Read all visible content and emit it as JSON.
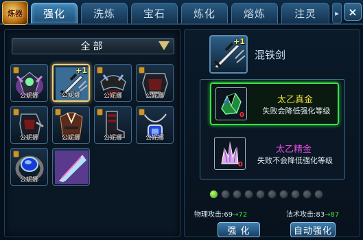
{
  "logo_text": "炼器",
  "tabs": [
    {
      "label": "强化",
      "active": true
    },
    {
      "label": "洗炼",
      "active": false
    },
    {
      "label": "宝石",
      "active": false
    },
    {
      "label": "炼化",
      "active": false
    },
    {
      "label": "熔炼",
      "active": false
    },
    {
      "label": "注灵",
      "active": false
    }
  ],
  "tab_more_icon": "chevron-right-icon",
  "close_label": "×",
  "filter": {
    "selected": "全部"
  },
  "inventory": [
    {
      "owner": "公妮娜",
      "icon": "armor-green-icon",
      "plus": "",
      "selected": false
    },
    {
      "owner": "公妮娜",
      "icon": "sword-icon",
      "plus": "+1",
      "selected": true
    },
    {
      "owner": "公妮娜",
      "icon": "shoulder-armor-icon",
      "plus": "",
      "selected": false
    },
    {
      "owner": "公妮娜",
      "icon": "chest-armor-icon",
      "plus": "",
      "selected": false
    },
    {
      "owner": "公妮娜",
      "icon": "gauntlet-icon",
      "plus": "",
      "selected": false
    },
    {
      "owner": "公妮娜",
      "icon": "robe-icon",
      "plus": "",
      "selected": false
    },
    {
      "owner": "公妮娜",
      "icon": "boots-icon",
      "plus": "",
      "selected": false
    },
    {
      "owner": "公妮娜",
      "icon": "necklace-icon",
      "plus": "",
      "selected": false
    },
    {
      "owner": "公妮娜",
      "icon": "ring-icon",
      "plus": "",
      "selected": false
    },
    {
      "owner": "",
      "icon": "fan-icon",
      "plus": "",
      "selected": false
    }
  ],
  "item": {
    "name": "混铁剑",
    "plus": "+1"
  },
  "materials": [
    {
      "title": "太乙真金",
      "desc": "失败会降低强化等级",
      "count": "0",
      "color": "#f2e13a",
      "selected": true
    },
    {
      "title": "太乙精金",
      "desc": "失败不会降低强化等级",
      "count": "0",
      "color": "#e24ce2",
      "selected": false
    }
  ],
  "level": {
    "current": 1,
    "max": 10
  },
  "stats": {
    "physical": {
      "label": "物理攻击:",
      "from": "69",
      "to": "72"
    },
    "magic": {
      "label": "法术攻击:",
      "from": "83",
      "to": "87"
    }
  },
  "buttons": {
    "enhance": "强 化",
    "auto_enhance": "自动强化"
  }
}
